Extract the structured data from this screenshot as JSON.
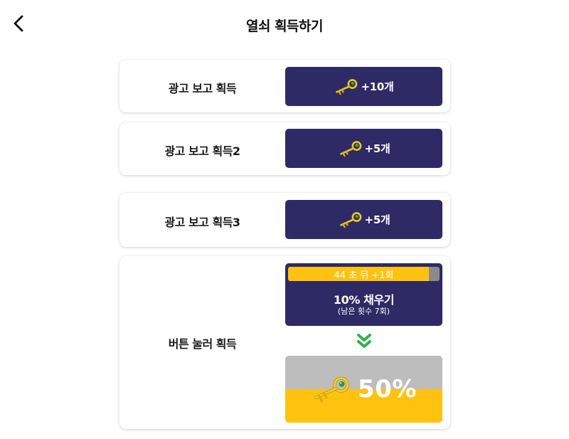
{
  "header": {
    "title": "열쇠 획득하기",
    "back_icon": "chevron-left-icon"
  },
  "reward_rows": [
    {
      "label": "광고 보고 획득",
      "reward": "+10개",
      "icon": "key-icon"
    },
    {
      "label": "광고 보고 획득2",
      "reward": "+5개",
      "icon": "key-icon"
    },
    {
      "label": "광고 보고 획득3",
      "reward": "+5개",
      "icon": "key-icon"
    }
  ],
  "button_fill": {
    "label": "버튼 눌러 획득",
    "timer_text": "44 초 뒤 +1회",
    "timer_progress": 0.93,
    "fill_title": "10% 채우기",
    "fill_subtitle": "(남은 횟수 7회)",
    "arrow_icon": "double-chevron-down-icon",
    "gauge_percent_text": "50%",
    "gauge_level": 0.5
  },
  "colors": {
    "button_navy": "#2e2a66",
    "gold": "#ffc20e",
    "arrow_green": "#2db34a",
    "gauge_empty": "#bdbdbd"
  }
}
